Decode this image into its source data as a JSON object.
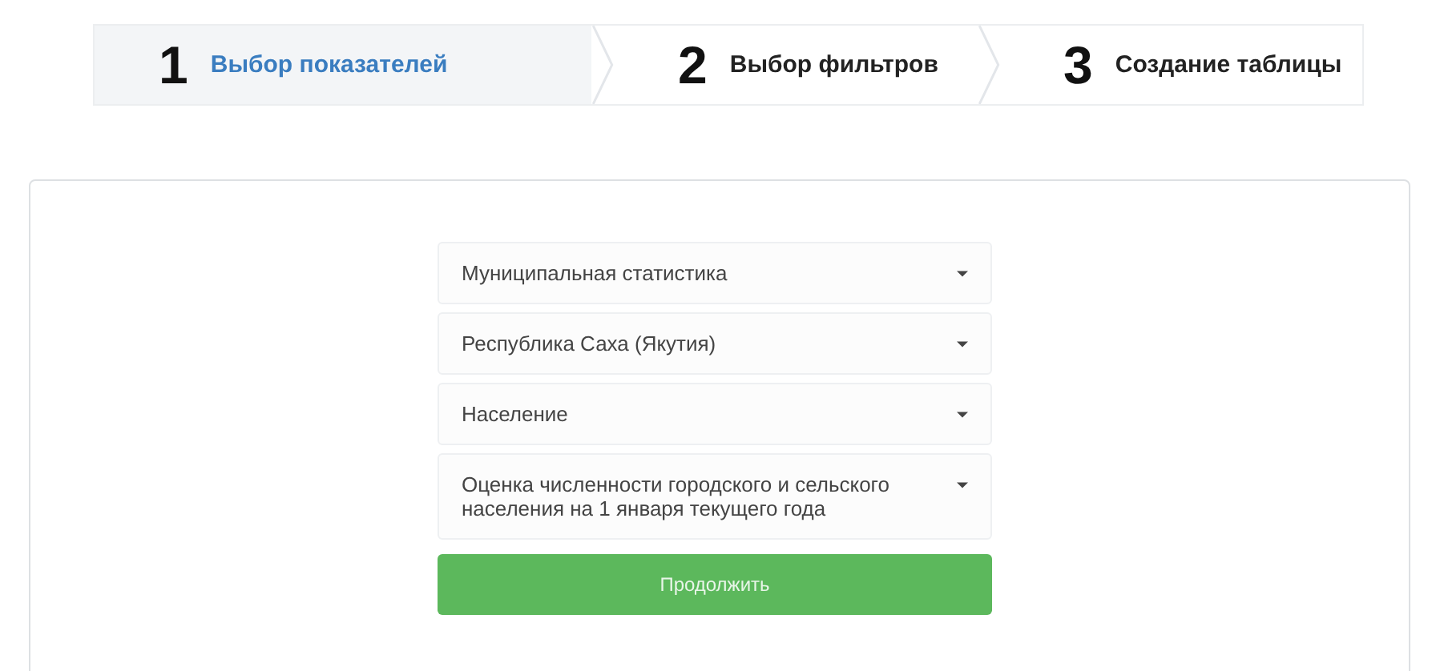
{
  "steps": [
    {
      "number": "1",
      "label": "Выбор показателей",
      "selected": true
    },
    {
      "number": "2",
      "label": "Выбор фильтров",
      "selected": false
    },
    {
      "number": "3",
      "label": "Создание таблицы",
      "selected": false
    }
  ],
  "selects": [
    {
      "value": "Муниципальная статистика"
    },
    {
      "value": "Республика Саха (Якутия)"
    },
    {
      "value": "Население"
    },
    {
      "value": "Оценка численности городского и сельского населения на 1 января текущего года"
    }
  ],
  "button": "Продолжить"
}
